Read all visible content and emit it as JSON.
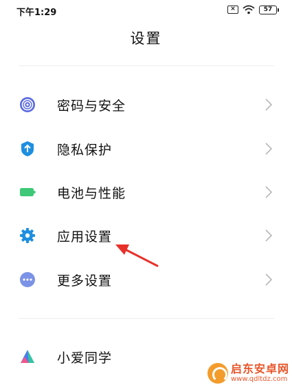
{
  "status_bar": {
    "time": "下午1:29",
    "sim_icon": "sim-off-icon",
    "sim_glyph": "×",
    "wifi_icon": "wifi-icon",
    "battery_level": "57",
    "battery_icon": "battery-icon"
  },
  "header": {
    "title": "设置"
  },
  "menu": {
    "items": [
      {
        "label": "密码与安全",
        "icon": "fingerprint-icon",
        "color": "#5b6be0"
      },
      {
        "label": "隐私保护",
        "icon": "privacy-shield-icon",
        "color": "#1e8fe0"
      },
      {
        "label": "电池与性能",
        "icon": "battery-icon",
        "color": "#3ec878"
      },
      {
        "label": "应用设置",
        "icon": "gear-icon",
        "color": "#1e8fe0"
      },
      {
        "label": "更多设置",
        "icon": "more-dots-icon",
        "color": "#7b92e6"
      },
      {
        "label": "小爱同学",
        "icon": "xiaoai-icon",
        "color": "#4a7cf0"
      }
    ]
  },
  "annotation": {
    "arrow_color": "#e8302a"
  },
  "watermark": {
    "name": "启东安卓网",
    "url": "www.qdltdz.com",
    "color": "#e8562a"
  }
}
